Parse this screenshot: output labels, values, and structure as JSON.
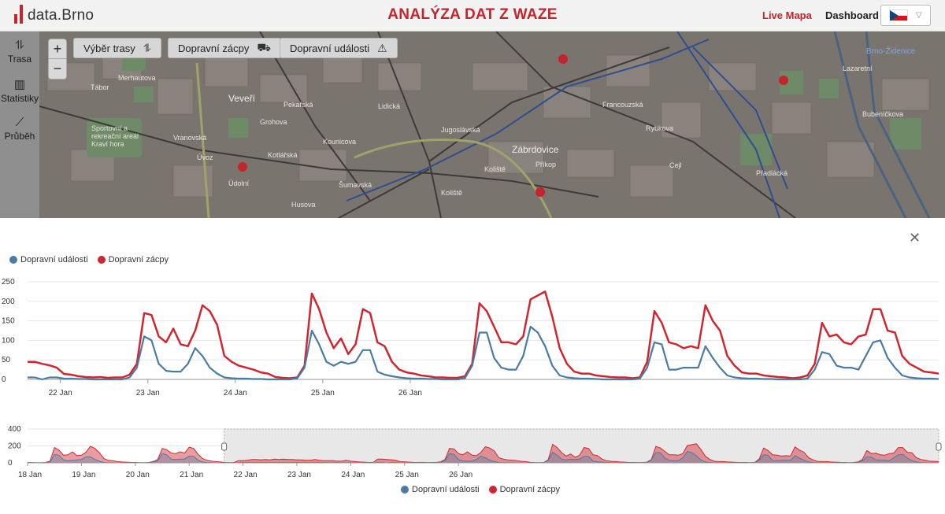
{
  "header": {
    "logo_text": "data.Brno",
    "title": "ANALÝZA DAT Z WAZE",
    "nav_live": "Live Mapa",
    "nav_dashboard": "Dashboard",
    "language_flag": "czech-flag"
  },
  "sidebar": {
    "items": [
      {
        "label": "Trasa",
        "icon": "route-icon"
      },
      {
        "label": "Statistiky",
        "icon": "bar-chart-icon"
      },
      {
        "label": "Průběh",
        "icon": "line-chart-icon"
      }
    ]
  },
  "map": {
    "zoom_in": "+",
    "zoom_out": "−",
    "buttons": [
      {
        "label": "Výběr trasy",
        "icon": "route-icon"
      },
      {
        "label": "Dopravní zácpy",
        "icon": "car-icon"
      },
      {
        "label": "Dopravní události",
        "icon": "warning-icon"
      }
    ],
    "labels": [
      "Veveří",
      "Zábrdovice",
      "Brno-Židenice",
      "Koliště",
      "Sportovní a rekreační areál Kraví hora",
      "Údolní",
      "Francouzská",
      "Cejl",
      "Bubeníčkova",
      "Merhautova",
      "Lazaretní",
      "Vranovská",
      "Přadlácká",
      "Kounicova",
      "Lidická",
      "Příkop",
      "Kotlářská",
      "Tábor",
      "Grohova",
      "Rybkova",
      "Šumavská",
      "Úvoz",
      "Jugoslávská",
      "Husova",
      "Pekařská",
      "Koliště"
    ],
    "colors": {
      "background": "#7a746f",
      "road_major": "#3a3a3a",
      "tram": "#2d4f8e",
      "hospital": "#c4242b"
    }
  },
  "panel": {
    "close_icon": "close-icon",
    "legend": [
      {
        "label": "Dopravní události",
        "color": "#4a7ba3"
      },
      {
        "label": "Dopravní zácpy",
        "color": "#d1262f"
      }
    ]
  },
  "chart_data": [
    {
      "type": "line",
      "title": "",
      "xlabel": "",
      "ylabel": "",
      "x_ticks": [
        "22 Jan",
        "23 Jan",
        "24 Jan",
        "25 Jan",
        "26 Jan"
      ],
      "ylim": [
        0,
        250
      ],
      "y_ticks": [
        0,
        50,
        100,
        150,
        200,
        250
      ],
      "grid": true,
      "legend_position": "top-left",
      "x_start": "2021-01-21T15:00",
      "x_step_hours": 2,
      "series": [
        {
          "name": "Dopravní zácpy",
          "color": "#d1262f",
          "values": [
            45,
            45,
            40,
            36,
            30,
            14,
            12,
            8,
            6,
            5,
            6,
            4,
            5,
            5,
            12,
            40,
            170,
            165,
            110,
            95,
            130,
            90,
            85,
            125,
            190,
            175,
            140,
            60,
            45,
            35,
            30,
            25,
            18,
            15,
            6,
            4,
            3,
            5,
            35,
            220,
            180,
            120,
            80,
            105,
            65,
            90,
            180,
            170,
            95,
            85,
            45,
            25,
            18,
            15,
            10,
            8,
            5,
            5,
            4,
            4,
            8,
            40,
            195,
            175,
            135,
            95,
            95,
            90,
            110,
            205,
            215,
            225,
            160,
            80,
            40,
            20,
            15,
            15,
            10,
            8,
            6,
            5,
            5,
            3,
            5,
            45,
            175,
            145,
            95,
            90,
            80,
            85,
            80,
            190,
            150,
            125,
            60,
            35,
            18,
            15,
            15,
            10,
            8,
            6,
            5,
            3,
            5,
            10,
            40,
            145,
            110,
            115,
            95,
            90,
            110,
            115,
            180,
            180,
            125,
            120,
            60,
            40,
            30,
            20,
            18,
            15
          ]
        },
        {
          "name": "Dopravní události",
          "color": "#4a7ba3",
          "values": [
            5,
            5,
            0,
            5,
            5,
            2,
            2,
            1,
            1,
            0,
            0,
            0,
            0,
            0,
            5,
            30,
            110,
            100,
            40,
            22,
            20,
            20,
            40,
            80,
            60,
            30,
            15,
            5,
            3,
            2,
            2,
            1,
            1,
            0,
            0,
            0,
            0,
            3,
            30,
            125,
            90,
            45,
            35,
            45,
            40,
            45,
            75,
            75,
            20,
            12,
            8,
            5,
            3,
            2,
            2,
            1,
            1,
            0,
            0,
            0,
            3,
            35,
            120,
            120,
            55,
            30,
            25,
            25,
            60,
            135,
            120,
            85,
            35,
            10,
            5,
            3,
            2,
            2,
            1,
            0,
            0,
            0,
            0,
            0,
            2,
            30,
            95,
            90,
            25,
            25,
            30,
            30,
            30,
            85,
            55,
            30,
            10,
            5,
            3,
            2,
            2,
            1,
            1,
            0,
            0,
            0,
            0,
            2,
            25,
            70,
            65,
            35,
            30,
            30,
            25,
            60,
            95,
            100,
            55,
            30,
            10,
            5,
            3,
            2,
            2,
            1
          ]
        }
      ]
    },
    {
      "type": "area",
      "title": "",
      "x_ticks": [
        "18 Jan",
        "19 Jan",
        "20 Jan",
        "21 Jan",
        "22 Jan",
        "23 Jan",
        "24 Jan",
        "25 Jan",
        "26 Jan"
      ],
      "ylim": [
        0,
        400
      ],
      "y_ticks": [
        0,
        200,
        400
      ],
      "legend_position": "bottom-center",
      "selected_range": [
        "21 Jan",
        "26 Jan"
      ],
      "x_start": "2021-01-18T00:00",
      "x_step_hours": 2,
      "series": [
        {
          "name": "Dopravní zácpy",
          "color": "#d1262f",
          "values": [
            5,
            4,
            3,
            3,
            5,
            20,
            180,
            150,
            90,
            95,
            130,
            85,
            90,
            125,
            195,
            170,
            120,
            50,
            30,
            25,
            15,
            10,
            8,
            5,
            5,
            3,
            3,
            5,
            15,
            40,
            170,
            155,
            115,
            110,
            130,
            115,
            185,
            170,
            100,
            50,
            30,
            20,
            15,
            10,
            5,
            3,
            5,
            25,
            25,
            30,
            40,
            40,
            35,
            40,
            35,
            45,
            40,
            45,
            40,
            40,
            35,
            35,
            30,
            30,
            40,
            30,
            25,
            25,
            25,
            20,
            20,
            30,
            20,
            15,
            10,
            8,
            5,
            5,
            45,
            45,
            40,
            36,
            30,
            14,
            12,
            8,
            6,
            5,
            6,
            4,
            5,
            5,
            12,
            40,
            170,
            165,
            110,
            95,
            130,
            90,
            85,
            125,
            190,
            175,
            140,
            60,
            45,
            35,
            30,
            25,
            18,
            15,
            6,
            4,
            3,
            5,
            35,
            220,
            180,
            120,
            80,
            105,
            65,
            90,
            180,
            170,
            95,
            85,
            45,
            25,
            18,
            15,
            10,
            8,
            5,
            5,
            4,
            4,
            8,
            40,
            195,
            175,
            135,
            95,
            95,
            90,
            110,
            205,
            215,
            225,
            160,
            80,
            40,
            20,
            15,
            15,
            10,
            8,
            6,
            5,
            5,
            3,
            5,
            45,
            175,
            145,
            95,
            90,
            80,
            85,
            80,
            190,
            150,
            125,
            60,
            35,
            18,
            15,
            15,
            10,
            8,
            6,
            5,
            3,
            5,
            10,
            40,
            145,
            110,
            115,
            95,
            90,
            110,
            115,
            180,
            180,
            125,
            120,
            60,
            40,
            30,
            20,
            18,
            15
          ]
        },
        {
          "name": "Dopravní události",
          "color": "#4a7ba3",
          "values": [
            0,
            0,
            0,
            0,
            0,
            10,
            100,
            90,
            35,
            25,
            30,
            35,
            40,
            70,
            70,
            40,
            20,
            5,
            3,
            2,
            1,
            0,
            0,
            0,
            0,
            0,
            0,
            0,
            5,
            25,
            110,
            95,
            45,
            40,
            45,
            45,
            80,
            75,
            30,
            10,
            5,
            2,
            1,
            0,
            0,
            0,
            0,
            3,
            5,
            5,
            5,
            5,
            5,
            5,
            5,
            5,
            5,
            5,
            5,
            5,
            5,
            5,
            5,
            5,
            5,
            5,
            5,
            3,
            3,
            3,
            3,
            3,
            3,
            2,
            1,
            0,
            0,
            0,
            5,
            5,
            0,
            5,
            5,
            2,
            2,
            1,
            1,
            0,
            0,
            0,
            0,
            0,
            5,
            30,
            110,
            100,
            40,
            22,
            20,
            20,
            40,
            80,
            60,
            30,
            15,
            5,
            3,
            2,
            2,
            1,
            1,
            0,
            0,
            0,
            0,
            3,
            30,
            125,
            90,
            45,
            35,
            45,
            40,
            45,
            75,
            75,
            20,
            12,
            8,
            5,
            3,
            2,
            2,
            1,
            1,
            0,
            0,
            0,
            3,
            35,
            120,
            120,
            55,
            30,
            25,
            25,
            60,
            135,
            120,
            85,
            35,
            10,
            5,
            3,
            2,
            2,
            1,
            0,
            0,
            0,
            0,
            0,
            2,
            30,
            95,
            90,
            25,
            25,
            30,
            30,
            30,
            85,
            55,
            30,
            10,
            5,
            3,
            2,
            2,
            1,
            1,
            0,
            0,
            0,
            0,
            2,
            25,
            70,
            65,
            35,
            30,
            30,
            25,
            60,
            95,
            100,
            55,
            30,
            10,
            5,
            3,
            2,
            2,
            1
          ]
        }
      ]
    }
  ]
}
